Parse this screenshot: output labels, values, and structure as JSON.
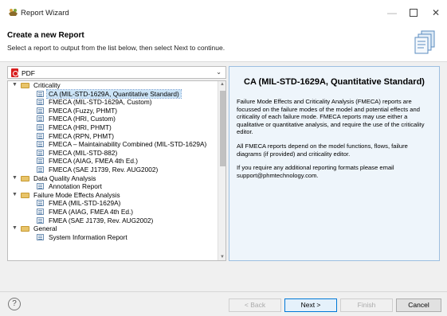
{
  "window": {
    "title": "Report Wizard",
    "minimize": "—",
    "close": "✕"
  },
  "header": {
    "title": "Create a new Report",
    "description": "Select a report to output from the list below, then select Next to continue."
  },
  "format_select": {
    "value": "PDF"
  },
  "tree": [
    {
      "kind": "folder",
      "label": "Criticality"
    },
    {
      "kind": "report",
      "label": "CA (MIL-STD-1629A, Quantitative Standard)",
      "selected": true
    },
    {
      "kind": "report",
      "label": "FMECA (MIL-STD-1629A, Custom)"
    },
    {
      "kind": "report",
      "label": "FMECA (Fuzzy, PHMT)"
    },
    {
      "kind": "report",
      "label": "FMECA (HRI, Custom)"
    },
    {
      "kind": "report",
      "label": "FMECA (HRI, PHMT)"
    },
    {
      "kind": "report",
      "label": "FMECA (RPN, PHMT)"
    },
    {
      "kind": "report",
      "label": "FMECA – Maintainability Combined (MIL-STD-1629A)"
    },
    {
      "kind": "report",
      "label": "FMECA (MIL-STD-882)"
    },
    {
      "kind": "report",
      "label": "FMECA (AIAG, FMEA 4th Ed.)"
    },
    {
      "kind": "report",
      "label": "FMECA (SAE J1739, Rev. AUG2002)"
    },
    {
      "kind": "folder",
      "label": "Data Quality Analysis"
    },
    {
      "kind": "report",
      "label": "Annotation Report"
    },
    {
      "kind": "folder",
      "label": "Failure Mode Effects Analysis"
    },
    {
      "kind": "report",
      "label": "FMEA (MIL-STD-1629A)"
    },
    {
      "kind": "report",
      "label": "FMEA (AIAG, FMEA 4th Ed.)"
    },
    {
      "kind": "report",
      "label": "FMEA (SAE J1739, Rev. AUG2002)"
    },
    {
      "kind": "folder",
      "label": "General"
    },
    {
      "kind": "report",
      "label": "System Information Report"
    }
  ],
  "description_panel": {
    "title": "CA (MIL-STD-1629A, Quantitative Standard)",
    "paragraphs": [
      "Failure Mode Effects and Criticality Analysis (FMECA) reports are focussed on the failure modes of the model and potential effects and criticality of each failure mode. FMECA reports may use either a qualitative or quantitative analysis, and require the use of the criticality editor.",
      "All FMECA reports depend on the model functions, flows, failure diagrams (if provided) and criticality editor.",
      "If you require any additional reporting formats please email support@phmtechnology.com."
    ]
  },
  "buttons": {
    "help": "?",
    "back": "< Back",
    "next": "Next >",
    "finish": "Finish",
    "cancel": "Cancel"
  }
}
